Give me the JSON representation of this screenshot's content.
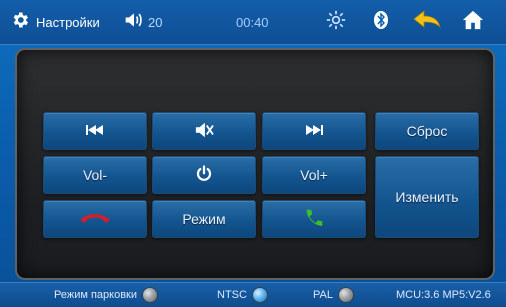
{
  "topbar": {
    "settings_label": "Настройки",
    "volume_value": "20",
    "clock": "00:40"
  },
  "panel": {
    "buttons": {
      "reset": "Сброс",
      "vol_minus": "Vol-",
      "vol_plus": "Vol+",
      "change": "Изменить",
      "mode": "Режим"
    }
  },
  "bottombar": {
    "parking_label": "Режим парковки",
    "ntsc_label": "NTSC",
    "pal_label": "PAL",
    "version": "MCU:3.6 MP5:V2.6"
  },
  "colors": {
    "accent_blue": "#0b5fae",
    "call_red": "#d0202c",
    "call_green": "#3bbf2a",
    "back_arrow": "#f3c21a"
  }
}
